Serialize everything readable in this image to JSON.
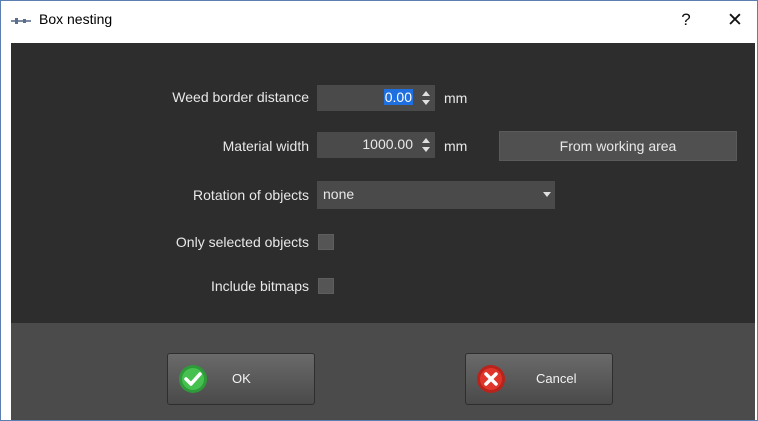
{
  "window": {
    "title": "Box nesting",
    "help_label": "?",
    "close_label": "✕"
  },
  "form": {
    "weed_border": {
      "label": "Weed border distance",
      "value": "0.00",
      "unit": "mm"
    },
    "material_width": {
      "label": "Material width",
      "value": "1000.00",
      "unit": "mm",
      "button_label": "From working area"
    },
    "rotation": {
      "label": "Rotation of objects",
      "value": "none"
    },
    "only_selected": {
      "label": "Only selected objects",
      "checked": false
    },
    "include_bitmaps": {
      "label": "Include bitmaps",
      "checked": false
    }
  },
  "buttons": {
    "ok_label": "OK",
    "cancel_label": "Cancel"
  },
  "icons": {
    "app": "app-logo-icon",
    "ok": "green-checkmark-icon",
    "cancel": "red-x-icon",
    "spin": "spin-arrows-icon",
    "dropdown": "chevron-down-icon"
  },
  "colors": {
    "dialog_body": "#2d2d2d",
    "footer": "#4b4b4b",
    "field": "#4a4a4a",
    "selection": "#1e6fe0",
    "ok_icon": "#3cb043",
    "cancel_icon": "#e0352b"
  }
}
